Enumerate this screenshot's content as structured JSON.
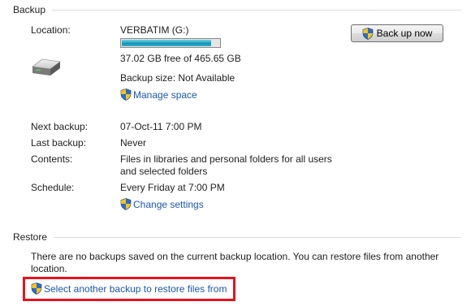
{
  "backup": {
    "section_title": "Backup",
    "location_label": "Location:",
    "location_value": "VERBATIM (G:)",
    "capacity_used_fraction": 0.92,
    "free_space_text": "37.02 GB free of 465.65 GB",
    "backup_size_text": "Backup size: Not Available",
    "manage_space_link": "Manage space",
    "back_up_now_button": "Back up now",
    "next_backup_label": "Next backup:",
    "next_backup_value": "07-Oct-11 7:00 PM",
    "last_backup_label": "Last backup:",
    "last_backup_value": "Never",
    "contents_label": "Contents:",
    "contents_value_line1": "Files in libraries and personal folders for all users",
    "contents_value_line2": "and selected folders",
    "schedule_label": "Schedule:",
    "schedule_value": "Every Friday at 7:00 PM",
    "change_settings_link": "Change settings"
  },
  "restore": {
    "section_title": "Restore",
    "message_line1": "There are no backups saved on the current backup location. You can restore files from another",
    "message_line2": "location.",
    "select_backup_link": "Select another backup to restore files from"
  },
  "icons": {
    "drive": "external-drive-icon",
    "shield": "uac-shield-icon"
  },
  "colors": {
    "link": "#1a56b3",
    "highlight": "#e8121e",
    "capacity_fill": "#27a6c4"
  }
}
